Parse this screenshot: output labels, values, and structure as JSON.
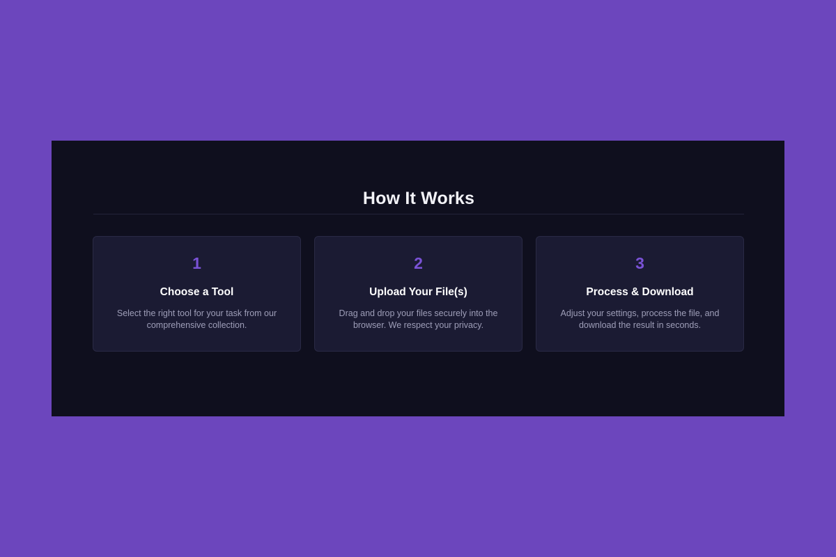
{
  "section": {
    "title": "How It Works"
  },
  "steps": [
    {
      "number": "1",
      "title": "Choose a Tool",
      "description": "Select the right tool for your task from our comprehensive collection."
    },
    {
      "number": "2",
      "title": "Upload Your File(s)",
      "description": "Drag and drop your files securely into the browser. We respect your privacy."
    },
    {
      "number": "3",
      "title": "Process & Download",
      "description": "Adjust your settings, process the file, and download the result in seconds."
    }
  ],
  "colors": {
    "background": "#6c46bd",
    "panel": "#0f0f1e",
    "card": "#1b1b33",
    "accent": "#7a52d6",
    "title_text": "#f2f2f7",
    "body_text": "#9e9eb8"
  }
}
